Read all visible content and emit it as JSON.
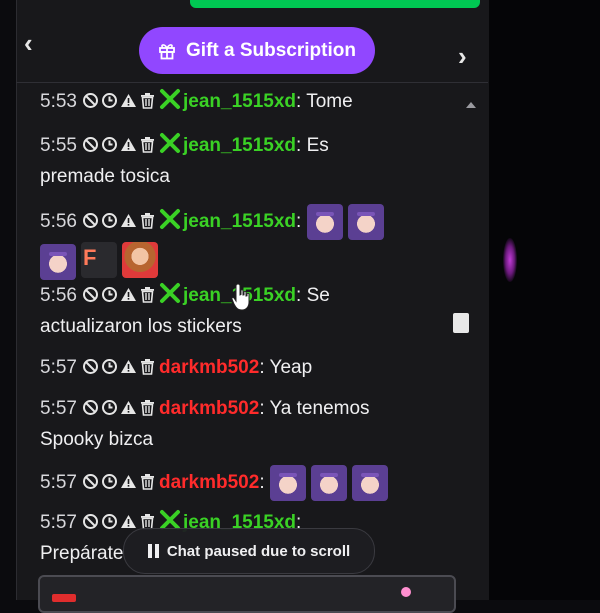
{
  "header": {
    "gift_label": "Gift a Subscription",
    "prev_icon": "chevron-left-icon",
    "next_icon": "chevron-right-icon"
  },
  "colors": {
    "accent": "#9147ff",
    "user_green": "#3ad125",
    "user_red": "#ff2b2b",
    "panel_bg": "#18181b"
  },
  "chat": {
    "messages": [
      {
        "time": "5:53",
        "user": "jean_1515xd",
        "sep": ":",
        "text": "Tome"
      },
      {
        "time": "5:55",
        "user": "jean_1515xd",
        "sep": ":",
        "text": "Es",
        "text2": "premade tosica"
      },
      {
        "time": "5:56",
        "user": "jean_1515xd",
        "sep": ":",
        "emotes": [
          "girl-emote",
          "girl-emote",
          "girl-emote",
          "f-girl-emote",
          "heart-emote"
        ]
      },
      {
        "time": "5:56",
        "user": "jean_1515xd",
        "sep": ":",
        "text": "Se",
        "text2": "actualizaron los stickers"
      },
      {
        "time": "5:57",
        "user": "darkmb502",
        "sep": ":",
        "text": "Yeap"
      },
      {
        "time": "5:57",
        "user": "darkmb502",
        "sep": ":",
        "text": "Ya tenemos",
        "text2": "Spooky bizca"
      },
      {
        "time": "5:57",
        "user": "darkmb502",
        "sep": ":",
        "emotes": [
          "girl-emote",
          "girl-emote",
          "girl-emote"
        ]
      },
      {
        "time": "5:57",
        "user": "jean_1515xd",
        "sep": ":",
        "text2": "Prepárate"
      }
    ],
    "emote_f_letter": "F",
    "paused_label": "Chat paused due to scroll"
  }
}
